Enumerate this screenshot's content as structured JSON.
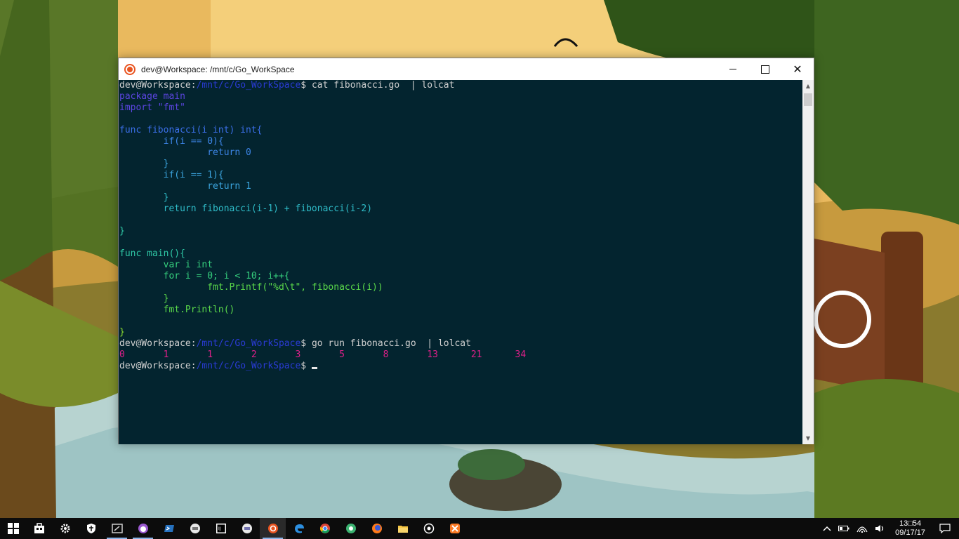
{
  "window": {
    "title": "dev@Workspace: /mnt/c/Go_WorkSpace",
    "minimize": "",
    "maximize": "",
    "close": "✕"
  },
  "terminal": {
    "prompt_user": "dev@Workspace:",
    "prompt_path": "/mnt/c/Go_WorkSpace",
    "prompt_sign": "$",
    "command1": " cat fibonacci.go  | lolcat",
    "code_lines": [
      "package main",
      "import \"fmt\"",
      "",
      "func fibonacci(i int) int{",
      "        if(i == 0){",
      "                return 0",
      "        }",
      "        if(i == 1){",
      "                return 1",
      "        }",
      "        return fibonacci(i-1) + fibonacci(i-2)",
      "",
      "}",
      "",
      "func main(){",
      "        var i int",
      "        for i = 0; i < 10; i++{",
      "                fmt.Printf(\"%d\\t\", fibonacci(i))",
      "        }",
      "        fmt.Println()",
      "",
      "}"
    ],
    "command2": " go run fibonacci.go  | lolcat",
    "output": "0       1       1       2       3       5       8       13      21      34",
    "command3": " "
  },
  "taskbar": {
    "apps": [
      "start",
      "store",
      "settings",
      "defender",
      "terminal-app",
      "cat-app",
      "powershell",
      "editor",
      "intellij",
      "editor2",
      "ubuntu",
      "edge",
      "chrome",
      "openshot",
      "firefox",
      "explorer",
      "media",
      "xampp"
    ],
    "tray": {
      "time": "13□54",
      "date": "09/17/17"
    }
  },
  "colors": {
    "terminal_bg": "#03242f",
    "taskbar_bg": "#0c0c0c",
    "ubuntu_orange": "#e95420"
  }
}
